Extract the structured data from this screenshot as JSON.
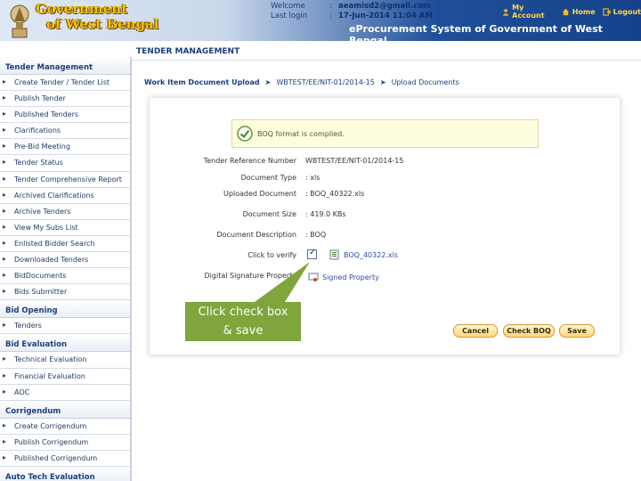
{
  "header": {
    "logo_line1": "Government",
    "logo_line2": "of West Bengal",
    "welcome_label": "Welcome",
    "welcome_value": "aeamisd2@gmail.com",
    "last_login_label": "Last login",
    "last_login_value": "17-Jun-2014 11:04 AM",
    "sep": ":",
    "links": {
      "my_account": "My Account",
      "home": "Home",
      "logout": "Logout"
    },
    "system_title": "eProcurement System of Government of West Bengal"
  },
  "page": {
    "section_title": "TENDER MANAGEMENT"
  },
  "sidebar": {
    "groups": [
      {
        "title": "Tender Management",
        "items": [
          "Create Tender / Tender List",
          "Publish Tender",
          "Published Tenders",
          "Clarifications",
          "Pre-Bid Meeting",
          "Tender Status",
          "Tender Comprehensive Report",
          "Archived Clarifications",
          "Archive Tenders",
          "View My Subs List",
          "Enlisted Bidder Search",
          "Downloaded Tenders",
          "BidDocuments",
          "Bids Submitter"
        ]
      },
      {
        "title": "Bid Opening",
        "items": [
          "Tenders"
        ]
      },
      {
        "title": "Bid Evaluation",
        "items": [
          "Technical Evaluation",
          "Financial Evaluation",
          "AOC"
        ]
      },
      {
        "title": "Corrigendum",
        "items": [
          "Create Corrigendum",
          "Publish Corrigendum",
          "Published Corrigendum"
        ]
      },
      {
        "title": "Auto Tech Evaluation",
        "items": []
      }
    ]
  },
  "breadcrumb": {
    "first": "Work Item Document Upload",
    "second": "WBTEST/EE/NIT-01/2014-15",
    "third": "Upload Documents",
    "arrow": "➤"
  },
  "notice": {
    "message": "BOQ format is complied."
  },
  "form": {
    "rows": [
      {
        "label": "Tender Reference Number",
        "value": "WBTEST/EE/NIT-01/2014-15"
      },
      {
        "label": "Document Type",
        "value": ": xls"
      },
      {
        "label": "Uploaded Document",
        "value": ": BOQ_40322.xls"
      },
      {
        "label": "Document Size",
        "value": ": 419.0 KBs"
      },
      {
        "label": "Document Description",
        "value": ": BOQ"
      }
    ],
    "verify_label": "Click to verify",
    "file_name": "BOQ_40322.xls",
    "signature_label": "Digital Signature Property",
    "signed_property": "Signed Property"
  },
  "buttons": {
    "cancel": "Cancel",
    "check_boq": "Check BOQ",
    "save": "Save"
  },
  "callout": {
    "line1": "Click check box",
    "line2": "& save"
  },
  "colors": {
    "accent_green": "#7fa53c",
    "header_blue": "#15428b",
    "button_orange": "#ffd77a"
  }
}
